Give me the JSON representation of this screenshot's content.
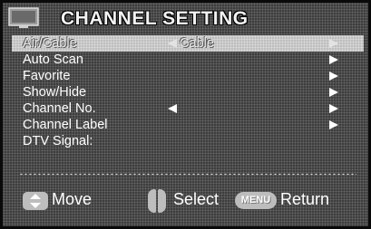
{
  "header": {
    "title": "CHANNEL SETTING",
    "icon": "tv-icon"
  },
  "menu": {
    "items": [
      {
        "label": "Air/Cable",
        "value": "Cable",
        "selected": true
      },
      {
        "label": "Auto Scan"
      },
      {
        "label": "Favorite"
      },
      {
        "label": "Show/Hide"
      },
      {
        "label": "Channel No."
      },
      {
        "label": "Channel Label"
      },
      {
        "label": "DTV Signal:"
      }
    ]
  },
  "footer": {
    "move_label": "Move",
    "select_label": "Select",
    "menu_key": "MENU",
    "return_label": "Return"
  },
  "colors": {
    "background": "#3d3d3d",
    "highlight": "#bdbdbd",
    "text": "#ffffff"
  }
}
